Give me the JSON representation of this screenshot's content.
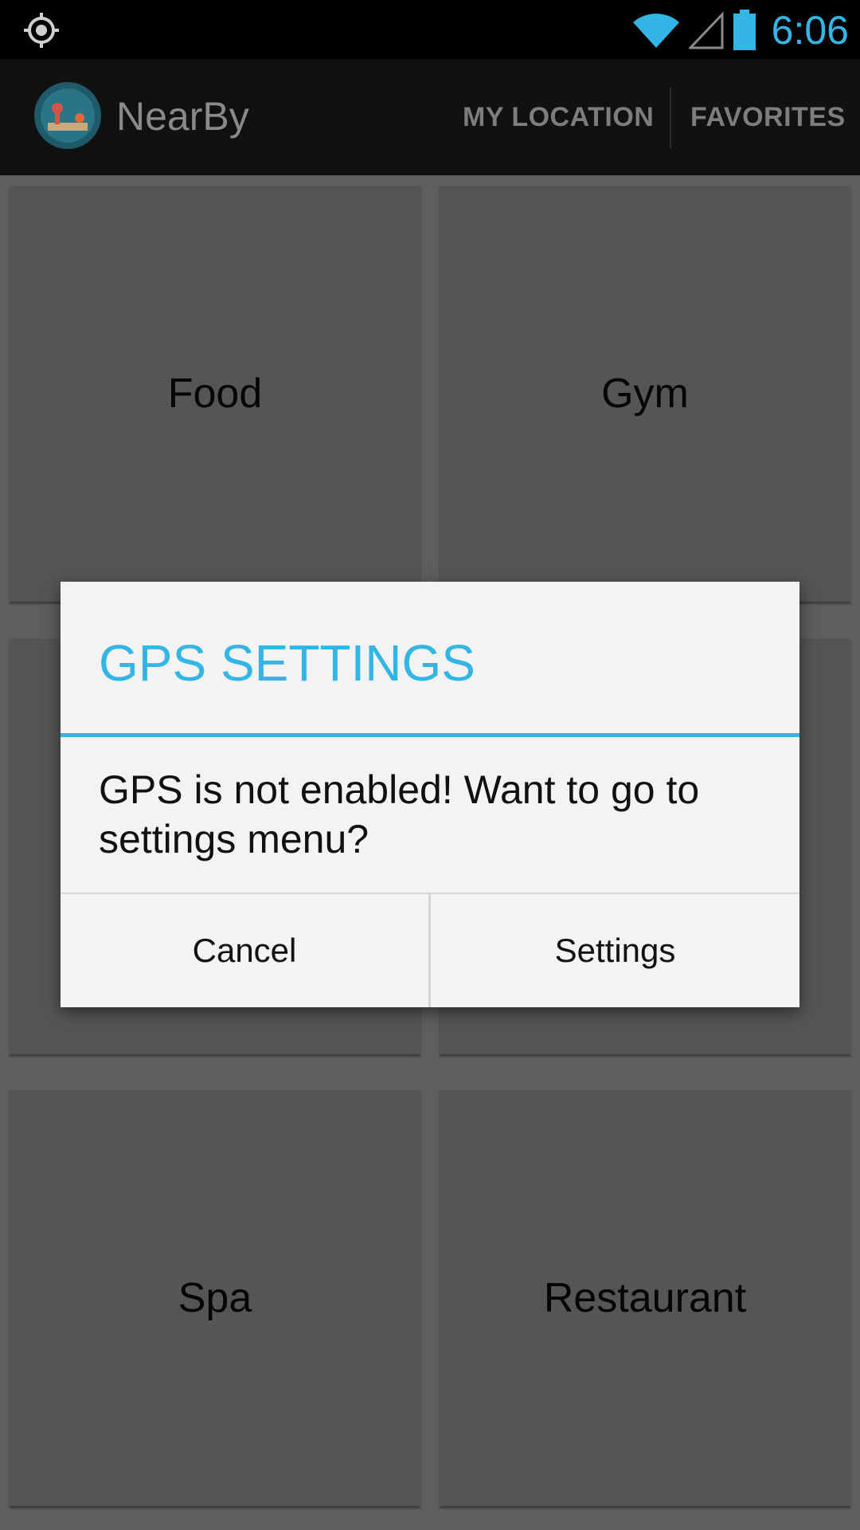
{
  "status_bar": {
    "time": "6:06",
    "icons": [
      "location-icon",
      "wifi-icon",
      "signal-icon",
      "battery-icon"
    ],
    "accent": "#33b5e5"
  },
  "action_bar": {
    "app_name": "NearBy",
    "actions": [
      "MY LOCATION",
      "FAVORITES"
    ]
  },
  "grid": {
    "tiles": [
      "Food",
      "Gym",
      "",
      "",
      "Spa",
      "Restaurant"
    ]
  },
  "dialog": {
    "title": "GPS SETTINGS",
    "message": "GPS is not enabled! Want to go to settings menu?",
    "buttons": {
      "cancel": "Cancel",
      "settings": "Settings"
    },
    "accent": "#33b5e5"
  }
}
